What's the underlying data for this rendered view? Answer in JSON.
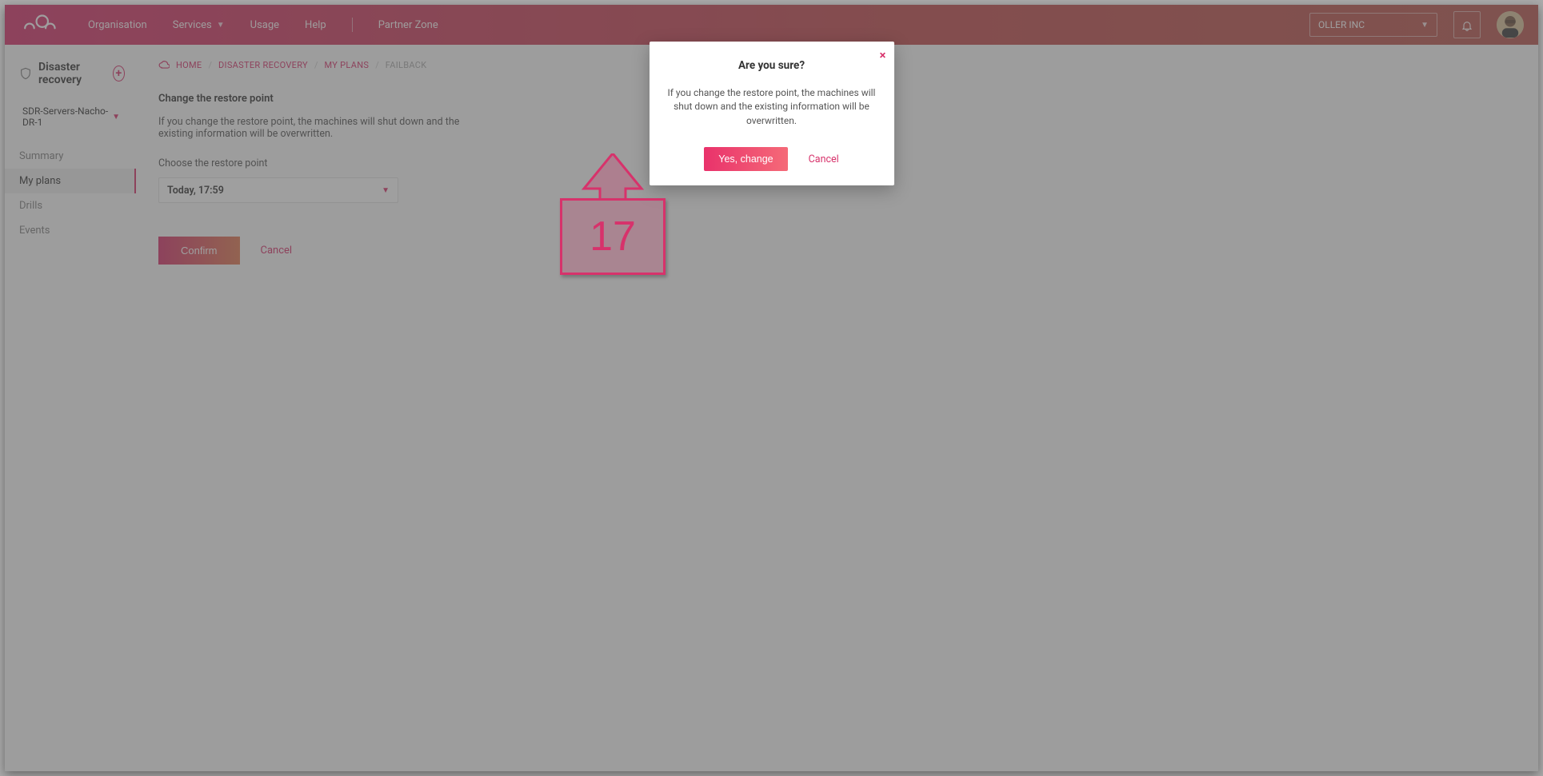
{
  "topnav": {
    "items": [
      "Organisation",
      "Services",
      "Usage",
      "Help"
    ],
    "partner": "Partner Zone",
    "org_selected": "OLLER INC"
  },
  "sidebar": {
    "title": "Disaster recovery",
    "plan_selected": "SDR-Servers-Nacho-DR-1",
    "items": [
      "Summary",
      "My plans",
      "Drills",
      "Events"
    ],
    "active_index": 1
  },
  "breadcrumb": {
    "home": "HOME",
    "items": [
      "DISASTER RECOVERY",
      "MY PLANS"
    ],
    "current": "FAILBACK"
  },
  "page": {
    "section_title": "Change the restore point",
    "helper": "If you change the restore point, the machines will shut down and the existing information will be overwritten.",
    "choose_label": "Choose the restore point",
    "restore_point_value": "Today, 17:59",
    "confirm": "Confirm",
    "cancel": "Cancel"
  },
  "modal": {
    "title": "Are you sure?",
    "body": "If you change the restore point, the machines will shut down and the existing information will be overwritten.",
    "yes": "Yes, change",
    "cancel": "Cancel"
  },
  "annotation": {
    "step": "17"
  }
}
